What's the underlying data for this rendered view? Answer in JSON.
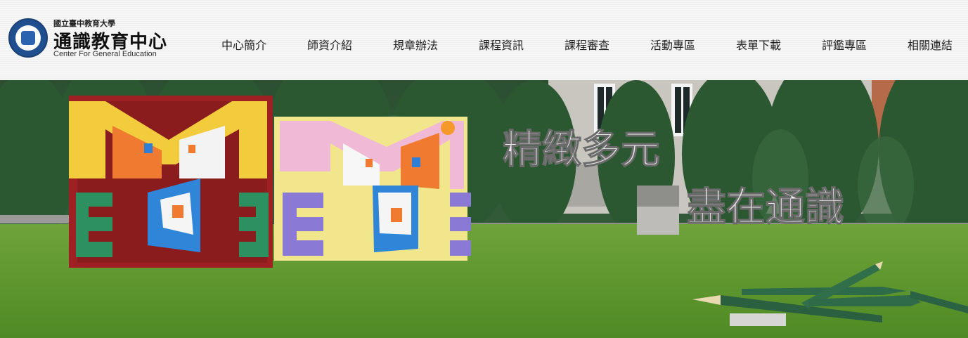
{
  "site": {
    "university": "國立臺中教育大學",
    "center_name": "通識教育中心",
    "center_name_en": "Center For General Education"
  },
  "nav": {
    "items": [
      {
        "label": "中心簡介"
      },
      {
        "label": "師資介紹"
      },
      {
        "label": "規章辦法"
      },
      {
        "label": "課程資訊"
      },
      {
        "label": "課程審查"
      },
      {
        "label": "活動專區"
      },
      {
        "label": "表單下載"
      },
      {
        "label": "評鑑專區"
      },
      {
        "label": "相關連結"
      }
    ]
  },
  "banner": {
    "headline_1": "精緻多元",
    "headline_2": "盡在通識"
  },
  "colors": {
    "brand_blue": "#1f4f8f",
    "grass": "#5f9f2f",
    "tree": "#2f5a34",
    "text_dark": "#222222"
  }
}
